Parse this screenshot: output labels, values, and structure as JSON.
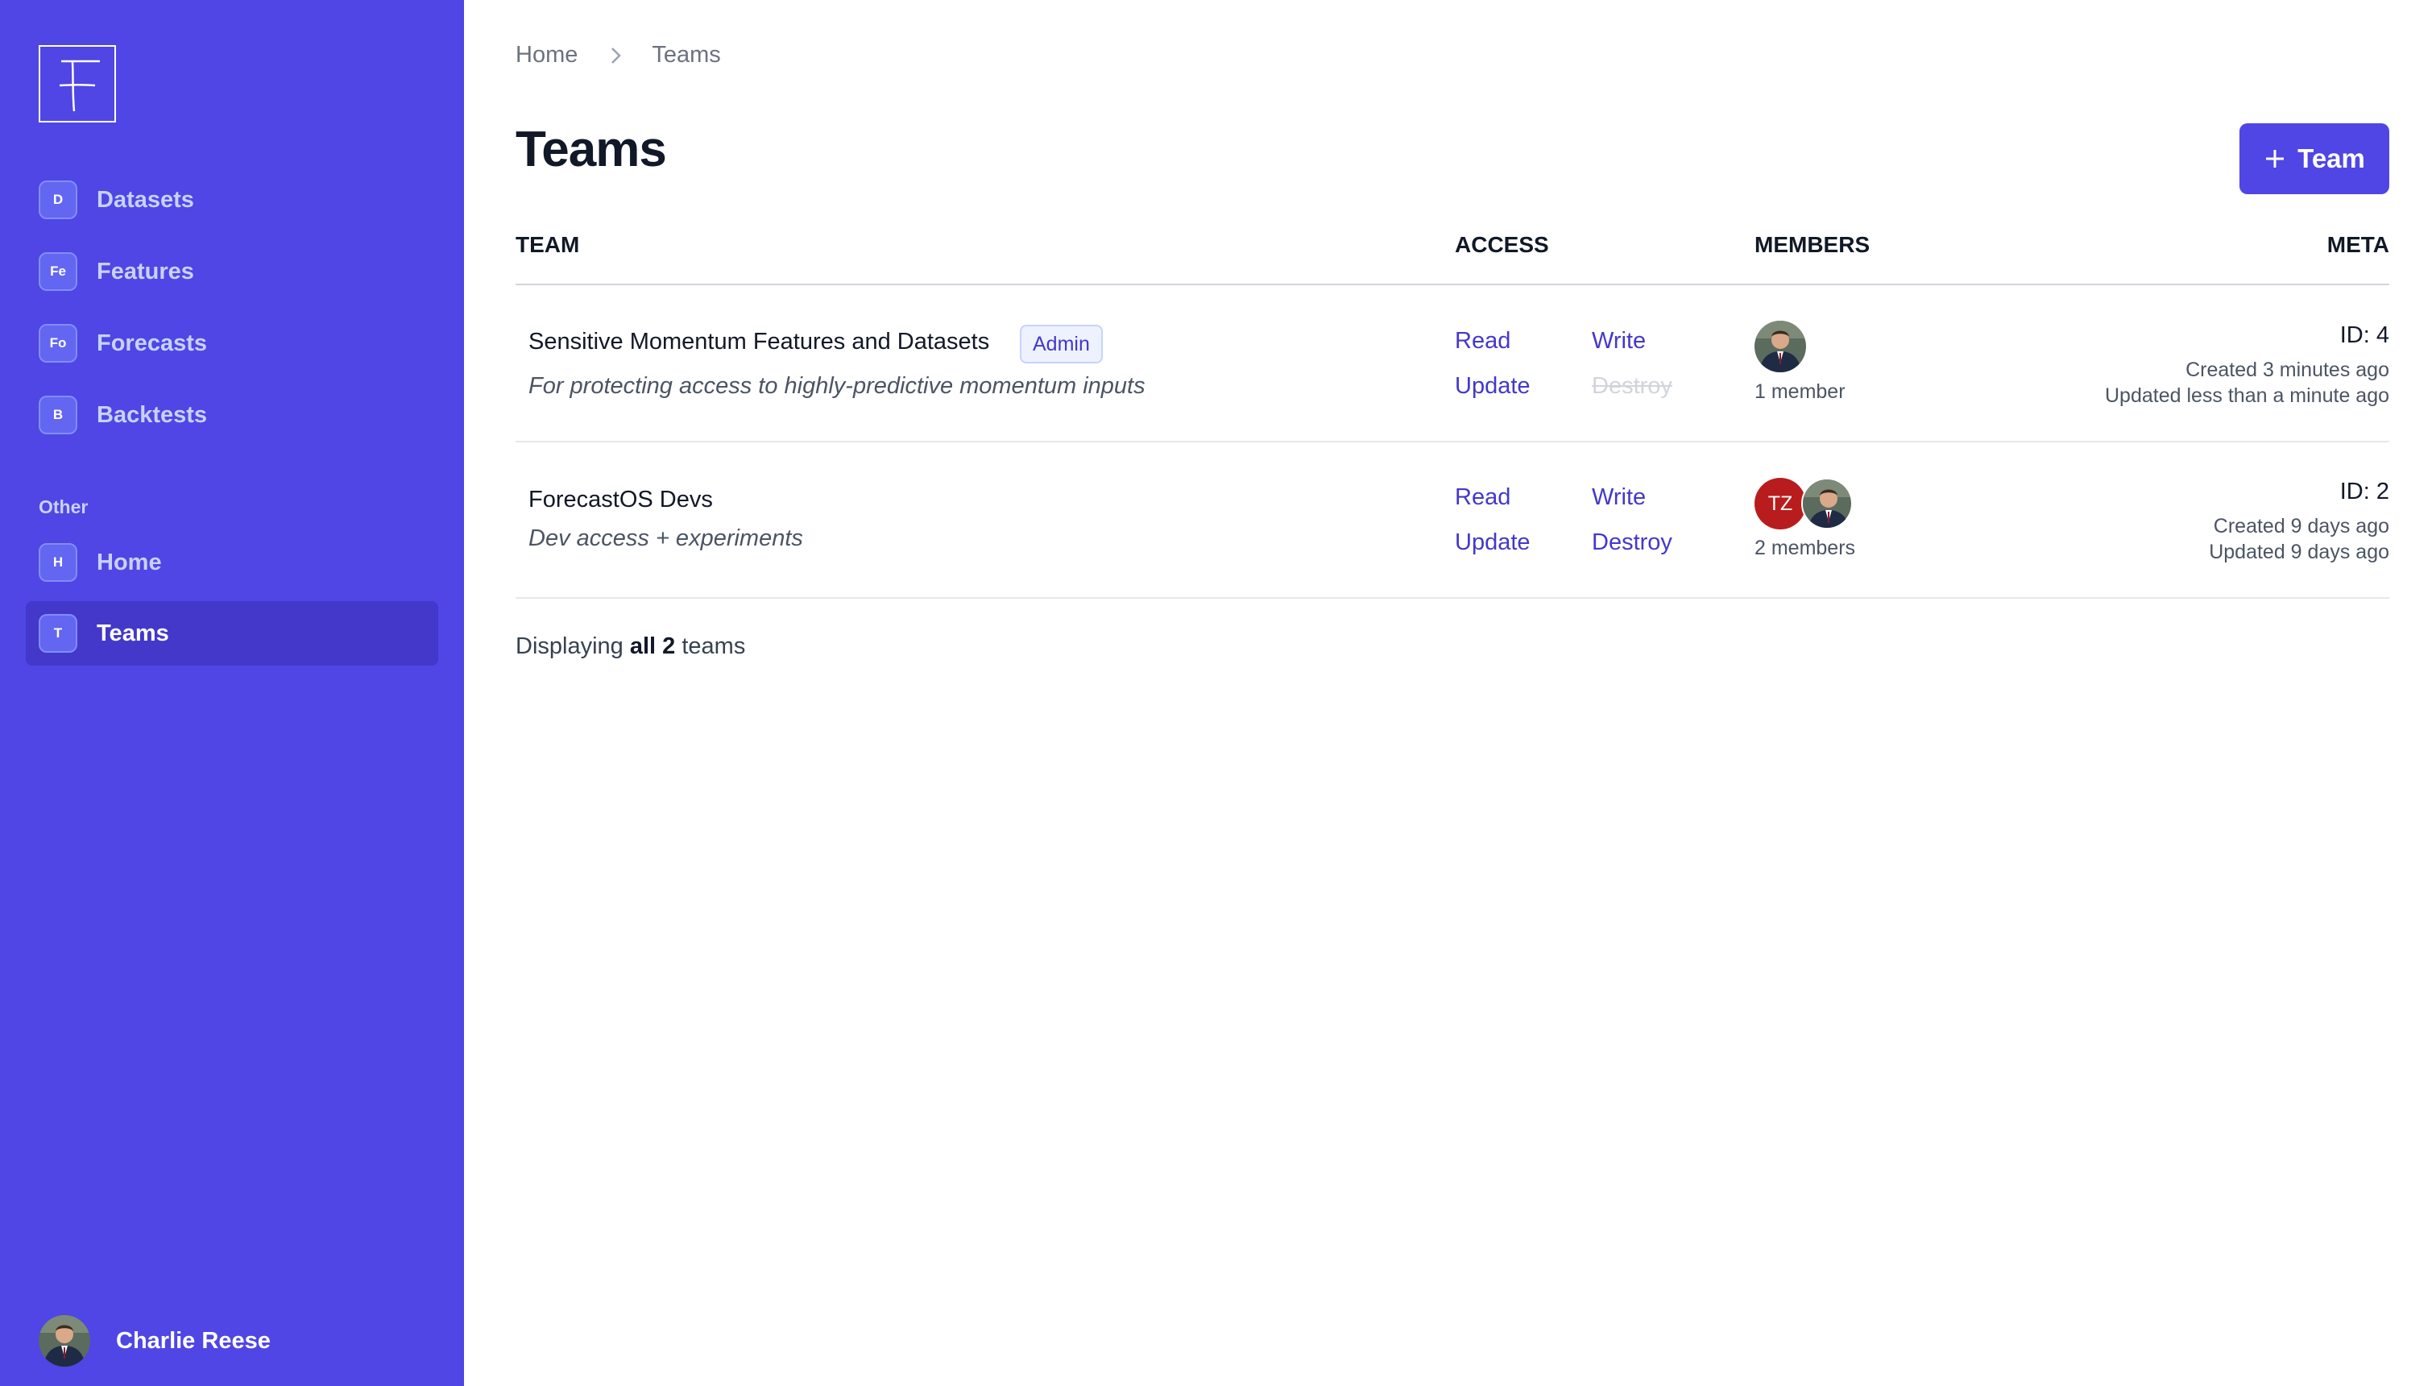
{
  "sidebar": {
    "items": [
      {
        "badge": "D",
        "label": "Datasets"
      },
      {
        "badge": "Fe",
        "label": "Features"
      },
      {
        "badge": "Fo",
        "label": "Forecasts"
      },
      {
        "badge": "B",
        "label": "Backtests"
      }
    ],
    "section_label": "Other",
    "other_items": [
      {
        "badge": "H",
        "label": "Home"
      },
      {
        "badge": "T",
        "label": "Teams",
        "active": true
      }
    ],
    "user": {
      "name": "Charlie Reese"
    }
  },
  "breadcrumb": {
    "items": [
      "Home",
      "Teams"
    ]
  },
  "page": {
    "title": "Teams",
    "add_button_label": "Team"
  },
  "table": {
    "headers": {
      "team": "TEAM",
      "access": "ACCESS",
      "members": "MEMBERS",
      "meta": "META"
    },
    "rows": [
      {
        "name": "Sensitive Momentum Features and Datasets",
        "badge": "Admin",
        "description": "For protecting access to highly-predictive momentum inputs",
        "permissions": {
          "read": "Read",
          "write": "Write",
          "update": "Update",
          "destroy": "Destroy",
          "destroy_enabled": false
        },
        "members_label": "1 member",
        "id_label": "ID: 4",
        "created": "Created 3 minutes ago",
        "updated": "Updated less than a minute ago"
      },
      {
        "name": "ForecastOS Devs",
        "description": "Dev access + experiments",
        "permissions": {
          "read": "Read",
          "write": "Write",
          "update": "Update",
          "destroy": "Destroy",
          "destroy_enabled": true
        },
        "member_initials": "TZ",
        "members_label": "2 members",
        "id_label": "ID: 2",
        "created": "Created 9 days ago",
        "updated": "Updated 9 days ago"
      }
    ]
  },
  "footer": {
    "prefix": "Displaying",
    "strong": "all 2",
    "suffix": "teams"
  },
  "colors": {
    "brand": "#4f46e5",
    "brand_dark": "#4338ca",
    "link": "#4338ca",
    "avatar_red": "#b91c1c"
  }
}
